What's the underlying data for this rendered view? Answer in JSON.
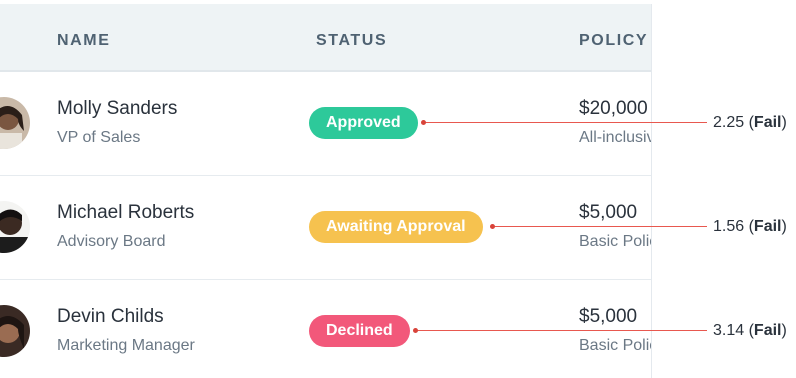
{
  "headers": {
    "name": "NAME",
    "status": "STATUS",
    "policy": "POLICY"
  },
  "rows": [
    {
      "name": "Molly Sanders",
      "role": "VP of Sales",
      "status": "Approved",
      "status_color": "#2dc99a",
      "price": "$20,000",
      "plan": "All-inclusive Policy",
      "score": "2.25",
      "verdict": "Fail",
      "avatar": "avatar-photo"
    },
    {
      "name": "Michael Roberts",
      "role": "Advisory Board",
      "status": "Awaiting Approval",
      "status_color": "#f6c24f",
      "price": "$5,000",
      "plan": "Basic Policy",
      "score": "1.56",
      "verdict": "Fail",
      "avatar": "avatar-photo"
    },
    {
      "name": "Devin Childs",
      "role": "Marketing Manager",
      "status": "Declined",
      "status_color": "#f2587a",
      "price": "$5,000",
      "plan": "Basic Policy",
      "score": "3.14",
      "verdict": "Fail",
      "avatar": "avatar-photo"
    }
  ],
  "annotation": {
    "open_paren": "(",
    "close_paren": ")",
    "line_color": "#e8584f"
  }
}
